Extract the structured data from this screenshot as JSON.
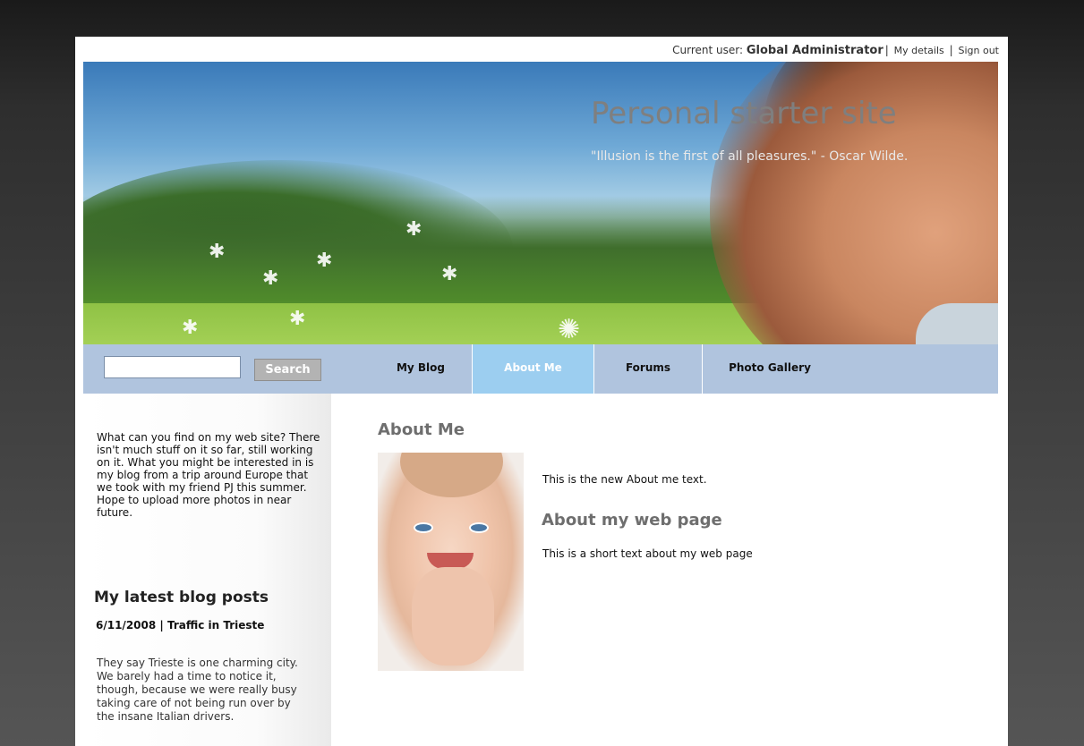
{
  "userbar": {
    "current_user_label": "Current user:",
    "user_name": "Global Administrator",
    "my_details": "My details",
    "sign_out": "Sign out"
  },
  "header": {
    "site_title": "Personal starter site",
    "quote": "\"Illusion is the first of all pleasures.\" - Oscar Wilde."
  },
  "nav": {
    "search_value": "",
    "search_button": "Search",
    "items": [
      {
        "label": "My Blog",
        "active": false
      },
      {
        "label": "About Me",
        "active": true
      },
      {
        "label": "Forums",
        "active": false
      },
      {
        "label": "Photo Gallery",
        "active": false
      }
    ]
  },
  "sidebar": {
    "intro": "What can you find on my web site? There isn't much stuff on it so far, still working on it. What you might be interested in is my blog from a trip around Europe that we took with my friend PJ this summer. Hope to upload more photos in near future.",
    "latest_heading": "My latest blog posts",
    "post_date": "6/11/2008",
    "post_sep": "|",
    "post_title": "Traffic in Trieste",
    "post_excerpt": "They say Trieste is one charming city. We barely had a time to notice it, though, because we were really busy taking care of not being run over by the insane Italian drivers."
  },
  "main": {
    "title": "About Me",
    "text1": "This is the new About me text.",
    "subtitle": "About my web page",
    "text2": "This is a short text about my web page"
  },
  "colors": {
    "nav_bg": "#b0c4de",
    "nav_active": "#9ccef0",
    "heading_gray": "#6e6e6e"
  }
}
